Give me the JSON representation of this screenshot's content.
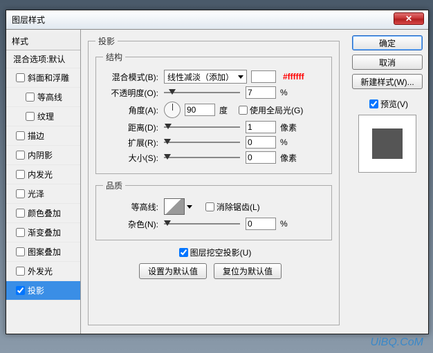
{
  "window": {
    "title": "图层样式"
  },
  "left": {
    "header": "样式",
    "blending": "混合选项:默认",
    "items": [
      {
        "label": "斜面和浮雕",
        "checked": false,
        "sub": false
      },
      {
        "label": "等高线",
        "checked": false,
        "sub": true
      },
      {
        "label": "纹理",
        "checked": false,
        "sub": true
      },
      {
        "label": "描边",
        "checked": false,
        "sub": false
      },
      {
        "label": "内阴影",
        "checked": false,
        "sub": false
      },
      {
        "label": "内发光",
        "checked": false,
        "sub": false
      },
      {
        "label": "光泽",
        "checked": false,
        "sub": false
      },
      {
        "label": "颜色叠加",
        "checked": false,
        "sub": false
      },
      {
        "label": "渐变叠加",
        "checked": false,
        "sub": false
      },
      {
        "label": "图案叠加",
        "checked": false,
        "sub": false
      },
      {
        "label": "外发光",
        "checked": false,
        "sub": false
      },
      {
        "label": "投影",
        "checked": true,
        "sub": false,
        "selected": true
      }
    ]
  },
  "right": {
    "ok": "确定",
    "cancel": "取消",
    "newstyle": "新建样式(W)...",
    "preview": "预览(V)",
    "preview_checked": true,
    "swatch_color": "#555555"
  },
  "center": {
    "section_title": "投影",
    "structure": {
      "legend": "结构",
      "blend_label": "混合模式(B):",
      "blend_value": "线性减淡（添加）",
      "hex": "#ffffff",
      "opacity_label": "不透明度(O):",
      "opacity_value": "7",
      "opacity_pct": "%",
      "opacity_thumb": 7,
      "angle_label": "角度(A):",
      "angle_value": "90",
      "angle_unit": "度",
      "global_label": "使用全局光(G)",
      "global_checked": false,
      "distance_label": "距离(D):",
      "distance_value": "1",
      "distance_unit": "像素",
      "distance_thumb": 1,
      "spread_label": "扩展(R):",
      "spread_value": "0",
      "spread_unit": "%",
      "spread_thumb": 0,
      "size_label": "大小(S):",
      "size_value": "0",
      "size_unit": "像素",
      "size_thumb": 0
    },
    "quality": {
      "legend": "品质",
      "contour_label": "等高线:",
      "aa_label": "消除锯齿(L)",
      "aa_checked": false,
      "noise_label": "杂色(N):",
      "noise_value": "0",
      "noise_unit": "%",
      "noise_thumb": 0
    },
    "knockout_label": "图层挖空投影(U)",
    "knockout_checked": true,
    "default_btn": "设置为默认值",
    "reset_btn": "复位为默认值"
  },
  "watermark": "UiBQ.CoM"
}
